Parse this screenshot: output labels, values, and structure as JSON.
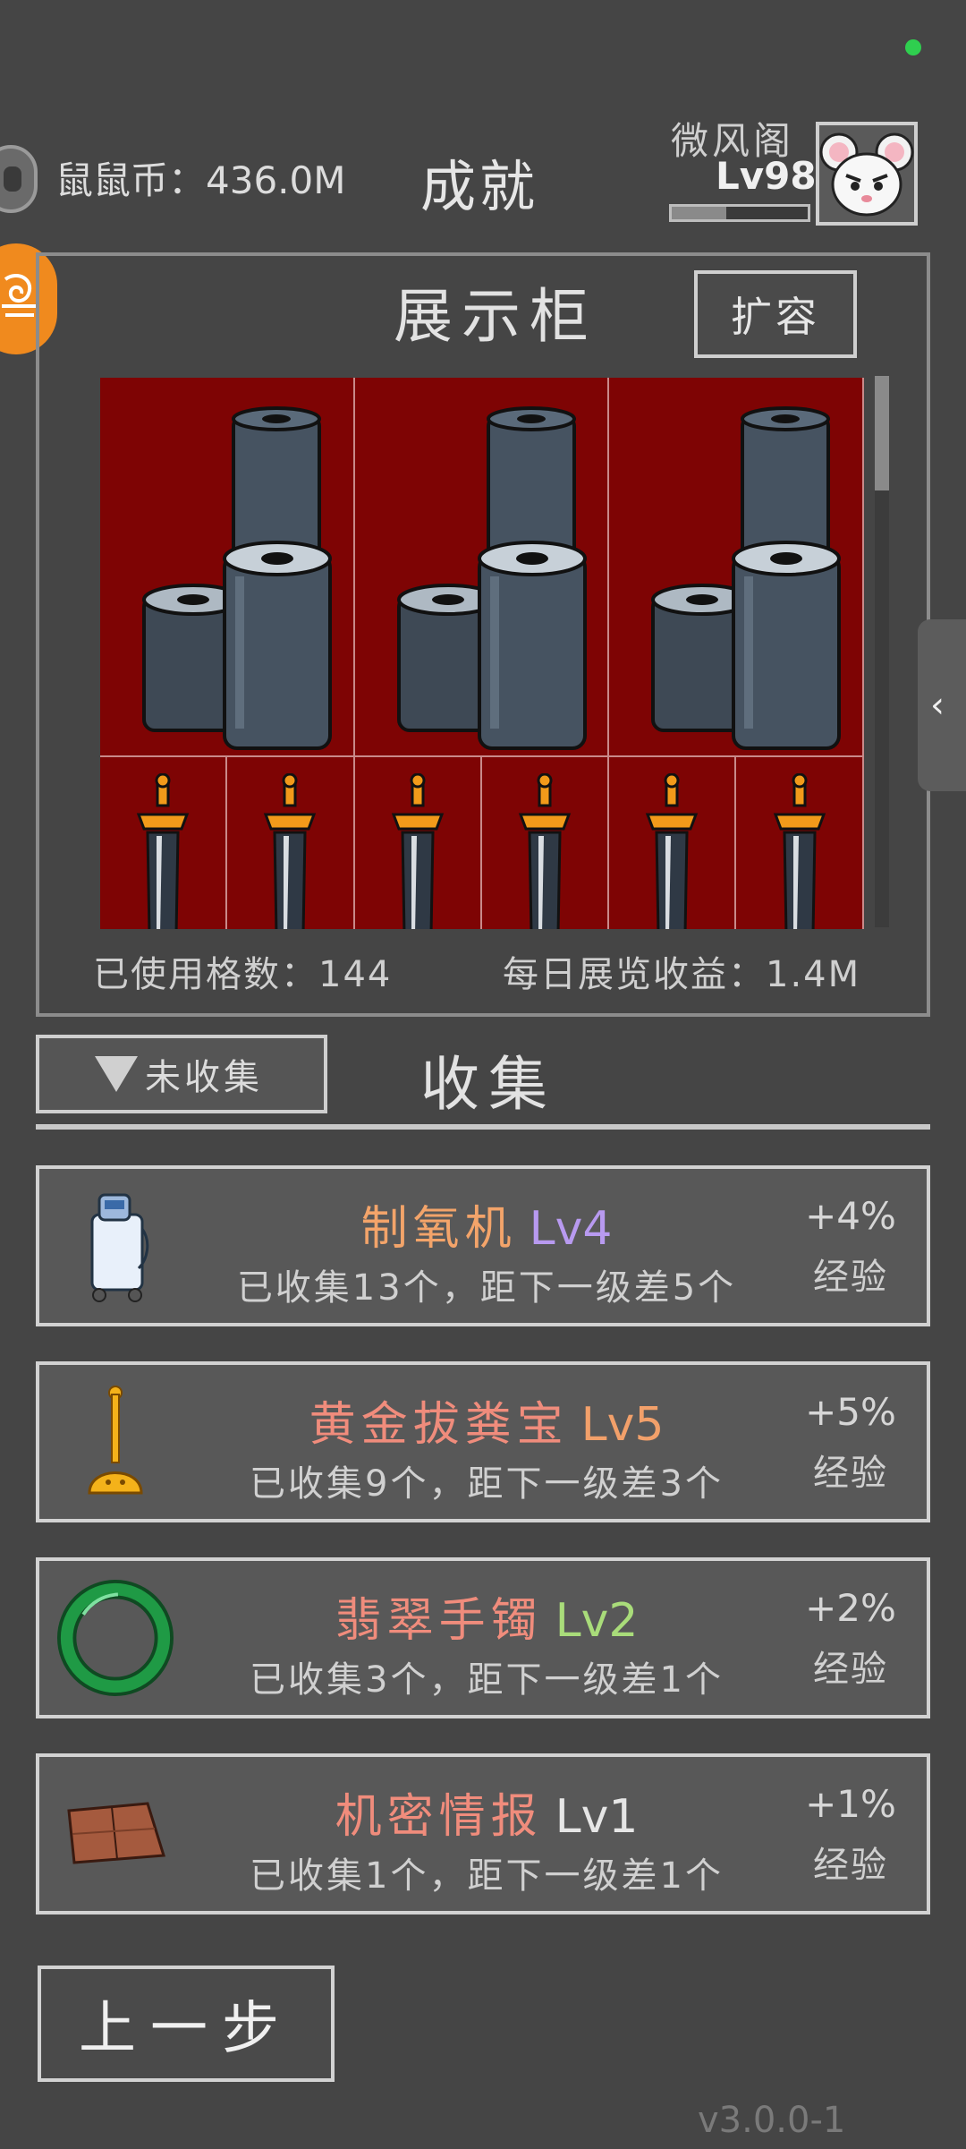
{
  "header": {
    "coin_label": "鼠鼠币：436.0M",
    "page_title": "成就",
    "player_name": "微风阁",
    "player_level": "Lv98",
    "exp_fraction": 0.4
  },
  "showcase": {
    "title": "展示柜",
    "expand_label": "扩容",
    "used_slots_label": "已使用格数：144",
    "daily_income_label": "每日展览收益：1.4M",
    "big_items": [
      "stacked-cylinders-icon",
      "stacked-cylinders-icon",
      "stacked-cylinders-icon"
    ],
    "small_items": [
      "golden-sword-icon",
      "golden-sword-icon",
      "golden-sword-icon",
      "golden-sword-icon",
      "golden-sword-icon",
      "golden-sword-icon"
    ],
    "cell_color": "#7e0404"
  },
  "collection": {
    "filter_label": "未收集",
    "title": "收集",
    "items": [
      {
        "name": "制氧机",
        "name_color": "#f3a46a",
        "level": "Lv4",
        "level_color": "#b89af0",
        "progress": "已收集13个，距下一级差5个",
        "bonus": "+4%",
        "bonus_label": "经验",
        "icon": "oxygen-machine-icon"
      },
      {
        "name": "黄金拔粪宝",
        "name_color": "#f08c7c",
        "level": "Lv5",
        "level_color": "#f2a06a",
        "progress": "已收集9个，距下一级差3个",
        "bonus": "+5%",
        "bonus_label": "经验",
        "icon": "golden-plunger-icon"
      },
      {
        "name": "翡翠手镯",
        "name_color": "#f08c7c",
        "level": "Lv2",
        "level_color": "#a9dc7a",
        "progress": "已收集3个，距下一级差1个",
        "bonus": "+2%",
        "bonus_label": "经验",
        "icon": "jade-bracelet-icon"
      },
      {
        "name": "机密情报",
        "name_color": "#f08c7c",
        "level": "Lv1",
        "level_color": "#e6e6e6",
        "progress": "已收集1个，距下一级差1个",
        "bonus": "+1%",
        "bonus_label": "经验",
        "icon": "secret-document-icon"
      }
    ]
  },
  "footer": {
    "back_label": "上一步",
    "version": "v3.0.0-1"
  }
}
